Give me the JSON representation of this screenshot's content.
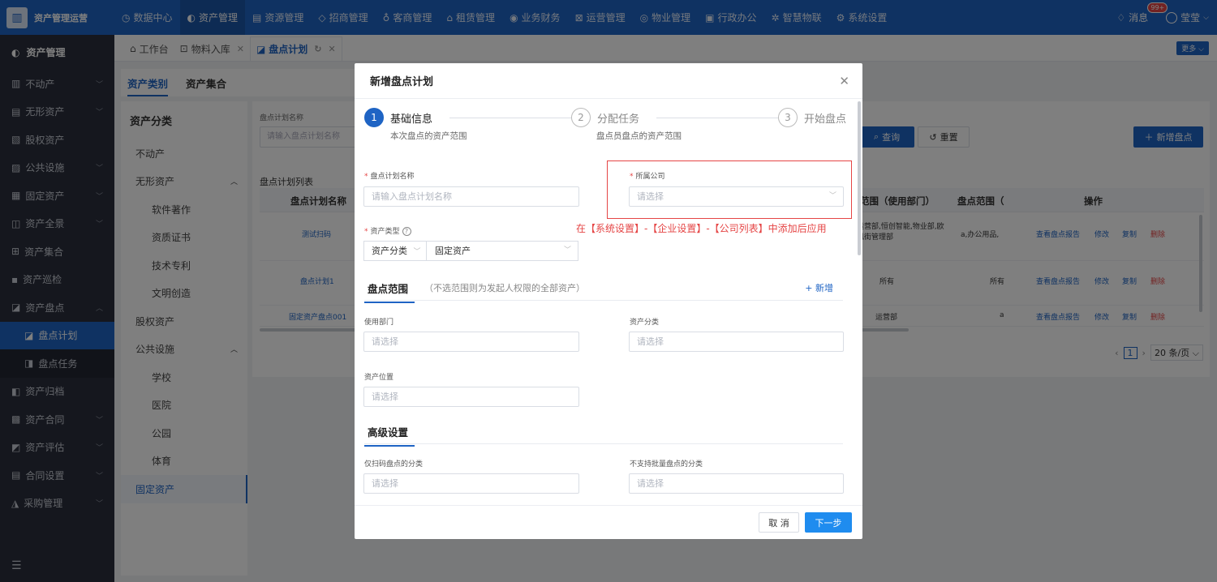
{
  "app": {
    "logo_text": "资产管理运营"
  },
  "topnav": [
    {
      "icon": "◷",
      "label": "数据中心"
    },
    {
      "icon": "◐",
      "label": "资产管理"
    },
    {
      "icon": "▤",
      "label": "资源管理"
    },
    {
      "icon": "◇",
      "label": "招商管理"
    },
    {
      "icon": "♁",
      "label": "客商管理"
    },
    {
      "icon": "⌂",
      "label": "租赁管理"
    },
    {
      "icon": "◉",
      "label": "业务财务"
    },
    {
      "icon": "⊠",
      "label": "运营管理"
    },
    {
      "icon": "◎",
      "label": "物业管理"
    },
    {
      "icon": "▣",
      "label": "行政办公"
    },
    {
      "icon": "✲",
      "label": "智慧物联"
    },
    {
      "icon": "⚙",
      "label": "系统设置"
    }
  ],
  "top_right": {
    "messages_label": "消息",
    "messages_badge": "99+",
    "user_name": "莹莹"
  },
  "sidebar": {
    "header": "资产管理",
    "items": [
      {
        "icon": "▥",
        "label": "不动产"
      },
      {
        "icon": "▤",
        "label": "无形资产"
      },
      {
        "icon": "▧",
        "label": "股权资产"
      },
      {
        "icon": "▨",
        "label": "公共设施"
      },
      {
        "icon": "▦",
        "label": "固定资产"
      },
      {
        "icon": "◫",
        "label": "资产全景"
      },
      {
        "icon": "⊞",
        "label": "资产集合"
      },
      {
        "icon": "▪",
        "label": "资产巡检"
      },
      {
        "icon": "◪",
        "label": "资产盘点"
      },
      {
        "icon": "◪",
        "label": "盘点计划"
      },
      {
        "icon": "◨",
        "label": "盘点任务"
      },
      {
        "icon": "◧",
        "label": "资产归档"
      },
      {
        "icon": "▩",
        "label": "资产合同"
      },
      {
        "icon": "◩",
        "label": "资产评估"
      },
      {
        "icon": "▤",
        "label": "合同设置"
      },
      {
        "icon": "◮",
        "label": "采购管理"
      }
    ]
  },
  "tabs": [
    {
      "label": "工作台"
    },
    {
      "label": "物料入库"
    },
    {
      "label": "盘点计划"
    }
  ],
  "more_label": "更多",
  "category_tabs": [
    "资产类别",
    "资产集合"
  ],
  "category_panel": {
    "title": "资产分类",
    "items": [
      "不动产",
      "无形资产",
      "软件著作",
      "资质证书",
      "技术专利",
      "文明创造",
      "股权资产",
      "公共设施",
      "学校",
      "医院",
      "公园",
      "体育",
      "固定资产"
    ]
  },
  "main": {
    "search_label": "盘点计划名称",
    "search_placeholder": "请输入盘点计划名称",
    "query_label": "查询",
    "reset_label": "重置",
    "new_label": "新增盘点",
    "list_title": "盘点计划列表",
    "columns": [
      "盘点计划名称",
      "范围（使用部门）",
      "盘点范围（",
      "操作"
    ],
    "rows": [
      {
        "name": "测试扫码",
        "dept": "运营部,恒创智能,物业部,欧风街管理部",
        "scope": "a,办公用品,"
      },
      {
        "name": "盘点计划1",
        "dept": "所有",
        "scope": "所有"
      },
      {
        "name": "固定资产盘点001",
        "dept": "运营部",
        "scope": "a"
      }
    ],
    "actions": [
      "查看盘点报告",
      "修改",
      "复制",
      "删除"
    ],
    "pager": {
      "current": "1",
      "size": "20 条/页"
    }
  },
  "modal": {
    "title": "新增盘点计划",
    "steps": [
      {
        "num": "1",
        "title": "基础信息",
        "desc": "本次盘点的资产范围"
      },
      {
        "num": "2",
        "title": "分配任务",
        "desc": "盘点员盘点的资产范围"
      },
      {
        "num": "3",
        "title": "开始盘点",
        "desc": ""
      }
    ],
    "plan_name_label": "盘点计划名称",
    "plan_name_placeholder": "请输入盘点计划名称",
    "company_label": "所属公司",
    "company_placeholder": "请选择",
    "asset_type_label": "资产类型",
    "asset_type_a": "资产分类",
    "asset_type_b": "固定资产",
    "annotation": "在【系统设置】-【企业设置】-【公司列表】中添加后应用",
    "scope_title": "盘点范围",
    "scope_hint": "（不选范围则为发起人权限的全部资产）",
    "scope_add": "+ 新增",
    "dept_label": "使用部门",
    "dept_placeholder": "请选择",
    "class_label": "资产分类",
    "class_placeholder": "请选择",
    "location_label": "资产位置",
    "location_placeholder": "请选择",
    "advanced_title": "高级设置",
    "scan_only_label": "仅扫码盘点的分类",
    "scan_only_placeholder": "请选择",
    "no_batch_label": "不支持批量盘点的分类",
    "no_batch_placeholder": "请选择",
    "cancel_label": "取 消",
    "next_label": "下一步"
  }
}
